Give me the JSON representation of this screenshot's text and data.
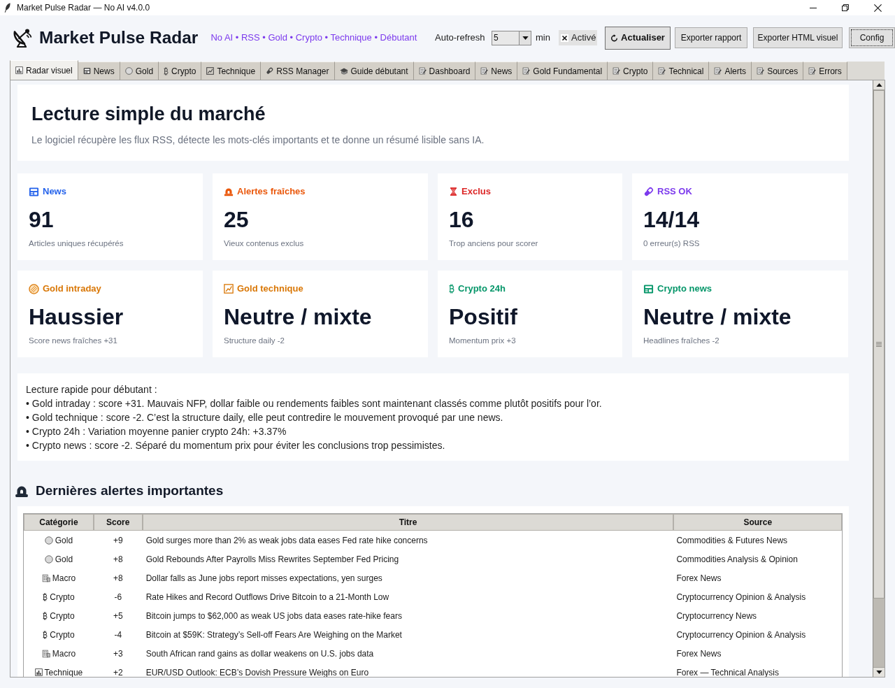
{
  "window": {
    "title": "Market Pulse Radar — No AI v4.0.0"
  },
  "header": {
    "title": "Market Pulse Radar",
    "tagline": "No AI • RSS • Gold • Crypto • Technique • Débutant",
    "auto_refresh": {
      "label": "Auto-refresh",
      "value": "5",
      "unit": "min",
      "toggle": {
        "label": "Activé",
        "checked": true
      }
    },
    "buttons": [
      {
        "label": "Actualiser",
        "kind": "primary",
        "focused": false
      },
      {
        "label": "Exporter rapport",
        "kind": "default",
        "focused": false
      },
      {
        "label": "Exporter HTML visuel",
        "kind": "default",
        "focused": false
      },
      {
        "label": "Config",
        "kind": "default",
        "focused": true
      }
    ]
  },
  "tabs": [
    {
      "label": "Radar visuel",
      "kind": "radar",
      "selected": true
    },
    {
      "label": "News",
      "kind": "news",
      "selected": false
    },
    {
      "label": "Gold",
      "kind": "gold",
      "selected": false
    },
    {
      "label": "Crypto",
      "kind": "crypto",
      "selected": false
    },
    {
      "label": "Technique",
      "kind": "technique",
      "selected": false
    },
    {
      "label": "RSS Manager",
      "kind": "rss",
      "selected": false
    },
    {
      "label": "Guide débutant",
      "kind": "guide",
      "selected": false
    },
    {
      "label": "Dashboard",
      "kind": "report",
      "selected": false
    },
    {
      "label": "News",
      "kind": "report",
      "selected": false
    },
    {
      "label": "Gold Fundamental",
      "kind": "report",
      "selected": false
    },
    {
      "label": "Crypto",
      "kind": "report",
      "selected": false
    },
    {
      "label": "Technical",
      "kind": "report",
      "selected": false
    },
    {
      "label": "Alerts",
      "kind": "report",
      "selected": false
    },
    {
      "label": "Sources",
      "kind": "report",
      "selected": false
    },
    {
      "label": "Errors",
      "kind": "report",
      "selected": false
    }
  ],
  "overview": {
    "title": "Lecture simple du marché",
    "subtitle": "Le logiciel récupère les flux RSS, détecte les mots-clés importants et te donne un résumé lisible sans IA."
  },
  "cards": [
    {
      "kind": "news",
      "label": "News",
      "color": "#2563eb",
      "value": "91",
      "note": "Articles uniques récupérés"
    },
    {
      "kind": "alerts",
      "label": "Alertes fraîches",
      "color": "#ea580c",
      "value": "25",
      "note": "Vieux contenus exclus"
    },
    {
      "kind": "excluded",
      "label": "Exclus",
      "color": "#dc2626",
      "value": "16",
      "note": "Trop anciens pour scorer"
    },
    {
      "kind": "rss",
      "label": "RSS OK",
      "color": "#7c3aed",
      "value": "14/14",
      "note": "0 erreur(s) RSS"
    },
    {
      "kind": "gold",
      "label": "Gold intraday",
      "color": "#d97706",
      "value": "Haussier",
      "note": "Score news fraîches +31"
    },
    {
      "kind": "technique",
      "label": "Gold technique",
      "color": "#d97706",
      "value": "Neutre / mixte",
      "note": "Structure daily -2"
    },
    {
      "kind": "crypto",
      "label": "Crypto 24h",
      "color": "#059669",
      "value": "Positif",
      "note": "Momentum prix +3"
    },
    {
      "kind": "crypto_news",
      "label": "Crypto news",
      "color": "#059669",
      "value": "Neutre / mixte",
      "note": "Headlines fraîches -2"
    }
  ],
  "summary": {
    "heading": "Lecture rapide pour débutant :",
    "lines": [
      "• Gold intraday : score +31. Mauvais NFP, dollar faible ou rendements faibles sont maintenant classés comme plutôt positifs pour l’or.",
      "• Gold technique : score -2. C’est la structure daily, elle peut contredire le mouvement provoqué par une news.",
      "• Crypto 24h : Variation moyenne panier crypto 24h: +3.37%",
      "• Crypto news : score -2. Séparé du momentum prix pour éviter les conclusions trop pessimistes."
    ]
  },
  "alerts": {
    "title": "Dernières alertes importantes",
    "table": {
      "columns": [
        "Catégorie",
        "Score",
        "Titre",
        "Source"
      ],
      "rows": [
        {
          "category": {
            "label": "Gold",
            "kind": "gold"
          },
          "score": "+9",
          "title": "Gold surges more than 2% as weak jobs data eases Fed rate hike concerns",
          "source": "Commodities & Futures News"
        },
        {
          "category": {
            "label": "Gold",
            "kind": "gold"
          },
          "score": "+8",
          "title": "Gold Rebounds After Payrolls Miss Rewrites September Fed Pricing",
          "source": "Commodities Analysis & Opinion"
        },
        {
          "category": {
            "label": "Macro",
            "kind": "macro"
          },
          "score": "+8",
          "title": "Dollar falls as June jobs report misses expectations, yen surges",
          "source": "Forex News"
        },
        {
          "category": {
            "label": "Crypto",
            "kind": "crypto"
          },
          "score": "-6",
          "title": "Rate Hikes and Record Outflows Drive Bitcoin to a 21-Month Low",
          "source": "Cryptocurrency Opinion & Analysis"
        },
        {
          "category": {
            "label": "Crypto",
            "kind": "crypto"
          },
          "score": "+5",
          "title": "Bitcoin jumps to $62,000 as weak US jobs data eases rate-hike fears",
          "source": "Cryptocurrency News"
        },
        {
          "category": {
            "label": "Crypto",
            "kind": "crypto"
          },
          "score": "-4",
          "title": "Bitcoin at $59K: Strategy’s Sell-off Fears Are Weighing on the Market",
          "source": "Cryptocurrency Opinion & Analysis"
        },
        {
          "category": {
            "label": "Macro",
            "kind": "macro"
          },
          "score": "+3",
          "title": "South African rand gains as dollar weakens on U.S. jobs data",
          "source": "Forex News"
        },
        {
          "category": {
            "label": "Technique",
            "kind": "technique"
          },
          "score": "+2",
          "title": "EUR/USD Outlook: ECB’s Dovish Pressure Weighs on Euro",
          "source": "Forex — Technical Analysis"
        }
      ]
    }
  }
}
